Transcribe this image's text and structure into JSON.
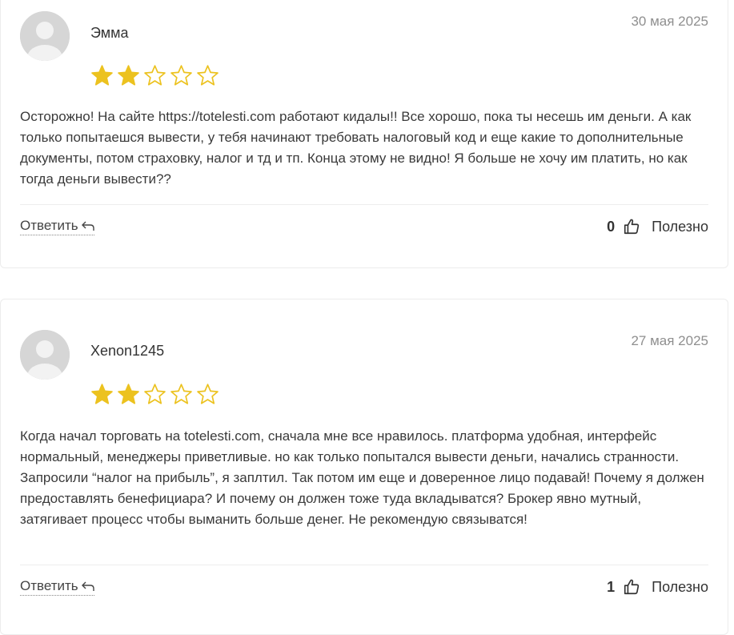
{
  "colors": {
    "star_fill": "#ECC21F",
    "star_outline": "#ECC21F",
    "text": "#3a3a3a",
    "date": "#8f8f8f"
  },
  "reviews": [
    {
      "author": "Эмма",
      "date": "30 мая 2025",
      "rating": 2,
      "rating_max": 5,
      "text": "Осторожно! На сайте https://totelesti.com работают кидалы!! Все хорошо, пока ты несешь им деньги. А как только попытаешся вывести, у тебя начинают требовать налоговый код и еще какие то дополнительные документы, потом страховку, налог и тд и тп. Конца этому не видно! Я больше не хочу им платить, но как тогда деньги вывести??",
      "reply_label": "Ответить",
      "helpful_count": "0",
      "helpful_label": "Полезно"
    },
    {
      "author": "Xenon1245",
      "date": "27 мая 2025",
      "rating": 2,
      "rating_max": 5,
      "text": "Когда начал торговать на totelesti.com, сначала мне все нравилось. платформа удобная, интерфейс нормальный, менеджеры приветливые. но как только попытался вывести деньги, начались странности. Запросили “налог на прибыль”, я заплтил. Так потом им еще и доверенное лицо подавай! Почему я должен предоставлять бенефициара? И почему он должен тоже туда вкладыватся? Брокер явно мутный, затягивает процесс чтобы выманить больше денег. Не рекомендую связыватся!",
      "reply_label": "Ответить",
      "helpful_count": "1",
      "helpful_label": "Полезно"
    }
  ],
  "icons": {
    "avatar": "user-avatar-icon",
    "star": "star-icon",
    "reply": "reply-arrow-icon",
    "like": "thumbs-up-icon"
  }
}
